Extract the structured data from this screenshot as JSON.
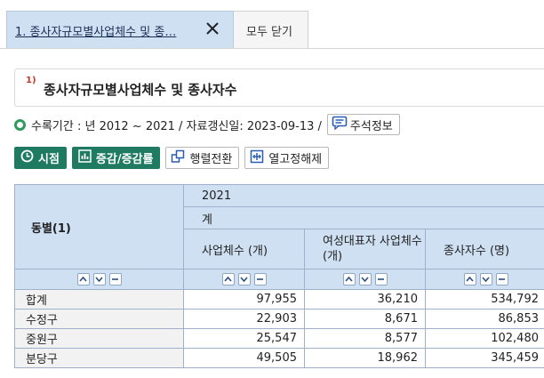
{
  "tabs": {
    "active_label": "1. 종사자규모별사업체수 및 종…",
    "close_all_label": "모두 닫기"
  },
  "title": {
    "sup": "1)",
    "text": "종사자규모별사업체수 및 종사자수"
  },
  "period": {
    "text": "수록기간 : 년 2012 ~ 2021 / 자료갱신일: 2023-09-13 /",
    "note_label": "주석정보"
  },
  "buttons": {
    "timepoint": "시점",
    "change": "증감/증감률",
    "transpose": "행렬전환",
    "unfix": "열고정해제"
  },
  "table": {
    "row_header": "동별(1)",
    "year": "2021",
    "group": "계",
    "columns": [
      "사업체수 (개)",
      "여성대표자 사업체수 (개)",
      "종사자수 (명)"
    ],
    "rows": [
      {
        "label": "합계",
        "values": [
          "97,955",
          "36,210",
          "534,792"
        ]
      },
      {
        "label": "수정구",
        "values": [
          "22,903",
          "8,671",
          "86,853"
        ]
      },
      {
        "label": "중원구",
        "values": [
          "25,547",
          "8,577",
          "102,480"
        ]
      },
      {
        "label": "분당구",
        "values": [
          "49,505",
          "18,962",
          "345,459"
        ]
      }
    ]
  },
  "colors": {
    "accent_green": "#1f7a62",
    "header_blue": "#cfe0f3",
    "sup_red": "#c0392b"
  }
}
